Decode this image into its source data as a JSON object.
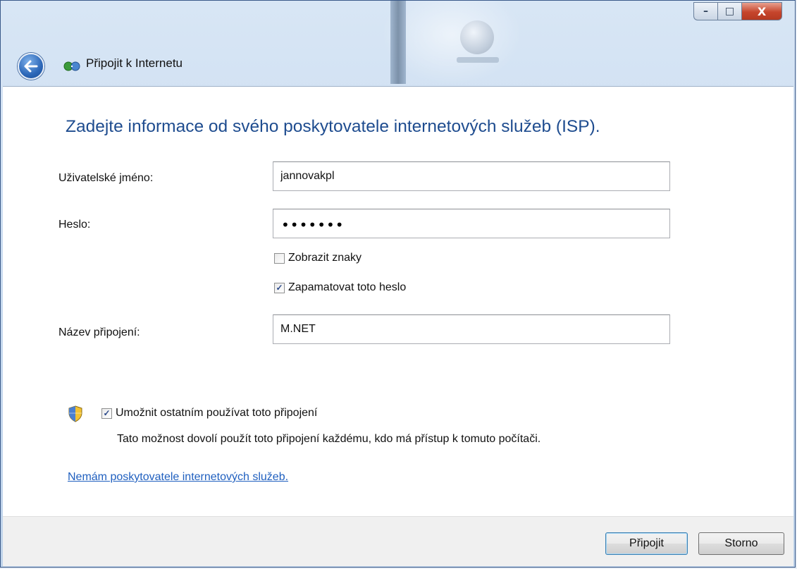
{
  "window": {
    "title": "Připojit k Internetu",
    "caption_buttons": {
      "minimize": "–",
      "maximize": "□",
      "close": "X"
    }
  },
  "form": {
    "heading": "Zadejte informace od svého poskytovatele internetových služeb (ISP).",
    "username": {
      "label": "Uživatelské jméno:",
      "value": "jannovakpl"
    },
    "password": {
      "label": "Heslo:",
      "masked": "•••••••"
    },
    "show_chars": {
      "label": "Zobrazit znaky",
      "checked": false
    },
    "remember": {
      "label": "Zapamatovat toto heslo",
      "checked": true,
      "mark": "✓"
    },
    "connection_name": {
      "label": "Název připojení:",
      "value": "M.NET"
    },
    "allow_others": {
      "label": "Umožnit ostatním používat toto připojení",
      "checked": true,
      "mark": "✓",
      "description": "Tato možnost dovolí použít toto připojení každému, kdo má přístup k tomuto počítači."
    },
    "no_isp_link": "Nemám poskytovatele internetových služeb."
  },
  "footer": {
    "connect_label": "Připojit",
    "cancel_label": "Storno"
  },
  "icons": {
    "back": "back-arrow-icon",
    "network": "network-icon",
    "shield": "uac-shield-icon"
  },
  "colors": {
    "heading": "#1e4c8f",
    "link": "#1f5fbf",
    "close_button": "#c6452c"
  }
}
